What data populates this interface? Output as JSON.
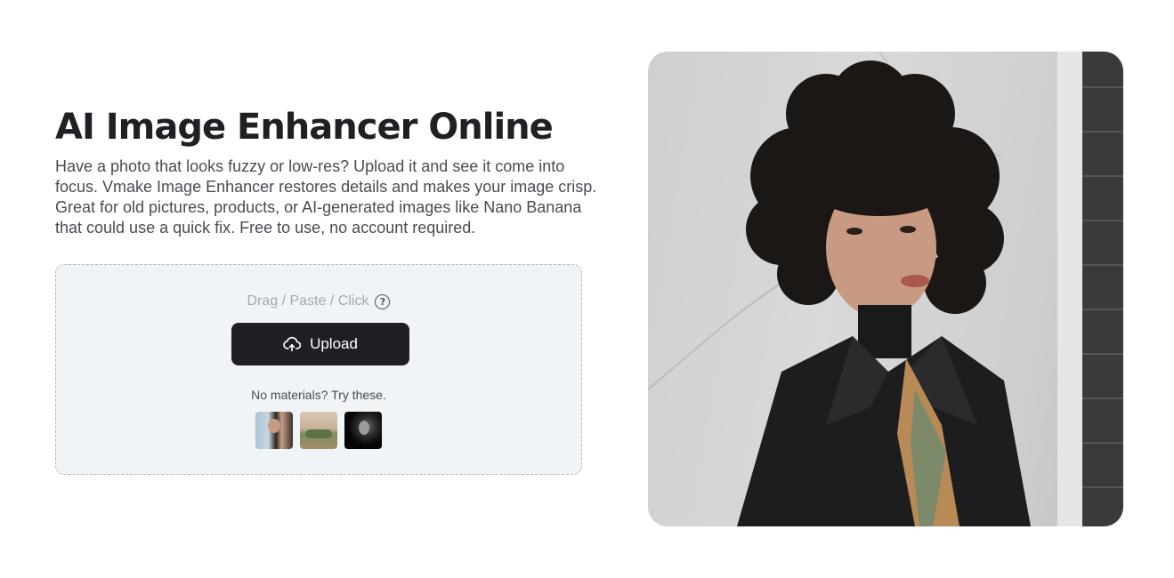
{
  "hero": {
    "title": "AI Image Enhancer Online",
    "description": "Have a photo that looks fuzzy or low-res? Upload it and see it come into focus. Vmake Image Enhancer restores details and makes your image crisp. Great for old pictures, products, or AI-generated images like Nano Banana that could use a quick fix. Free to use, no account required."
  },
  "dropzone": {
    "hint": "Drag / Paste / Click",
    "help_icon": "question-circle-icon",
    "upload_label": "Upload",
    "upload_icon": "cloud-upload-icon",
    "samples_label": "No materials? Try these.",
    "samples": [
      {
        "name": "sample-portrait-woman"
      },
      {
        "name": "sample-interior-room"
      },
      {
        "name": "sample-bw-portrait"
      }
    ]
  },
  "colors": {
    "button_bg": "#1f2026",
    "dropzone_bg": "#f1f4f7",
    "title": "#1f2024"
  }
}
